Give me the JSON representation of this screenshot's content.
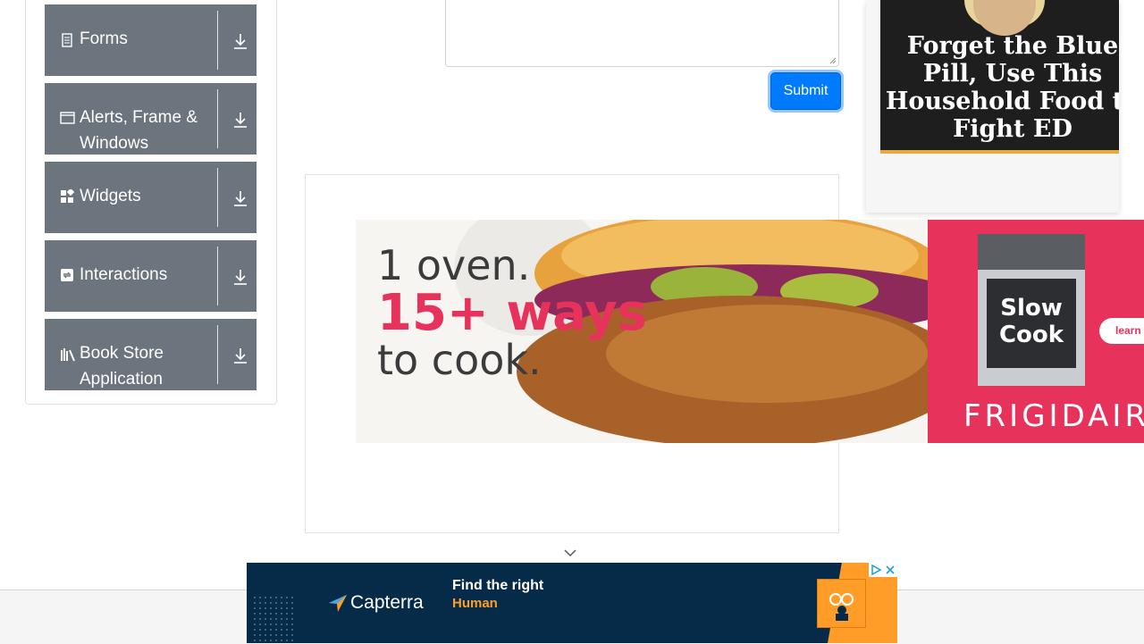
{
  "menu": {
    "groups": [
      {
        "label": "Forms",
        "icon": "form-icon"
      },
      {
        "label": "Alerts, Frame & Windows",
        "icon": "window-icon"
      },
      {
        "label": "Widgets",
        "icon": "widgets-icon"
      },
      {
        "label": "Interactions",
        "icon": "interactions-icon"
      },
      {
        "label": "Book Store Application",
        "icon": "book-icon"
      }
    ]
  },
  "form": {
    "submit_label": "Submit",
    "submit_color": "#007bff"
  },
  "ads": {
    "frigidaire": {
      "line1": "1 oven.",
      "line2": "15+ ways",
      "line3": "to cook.",
      "badge": "Slow Cook",
      "brand": "FRIGIDAIRE",
      "cta": "learn",
      "accent": "#e7335c"
    },
    "blue_pill": {
      "headline": "Forget the Blue Pill, Use This Household Food to Fight ED"
    },
    "capterra": {
      "logo": "Capterra",
      "line1": "Find the right",
      "line2": "Human",
      "accent": "#ff9d28"
    }
  }
}
